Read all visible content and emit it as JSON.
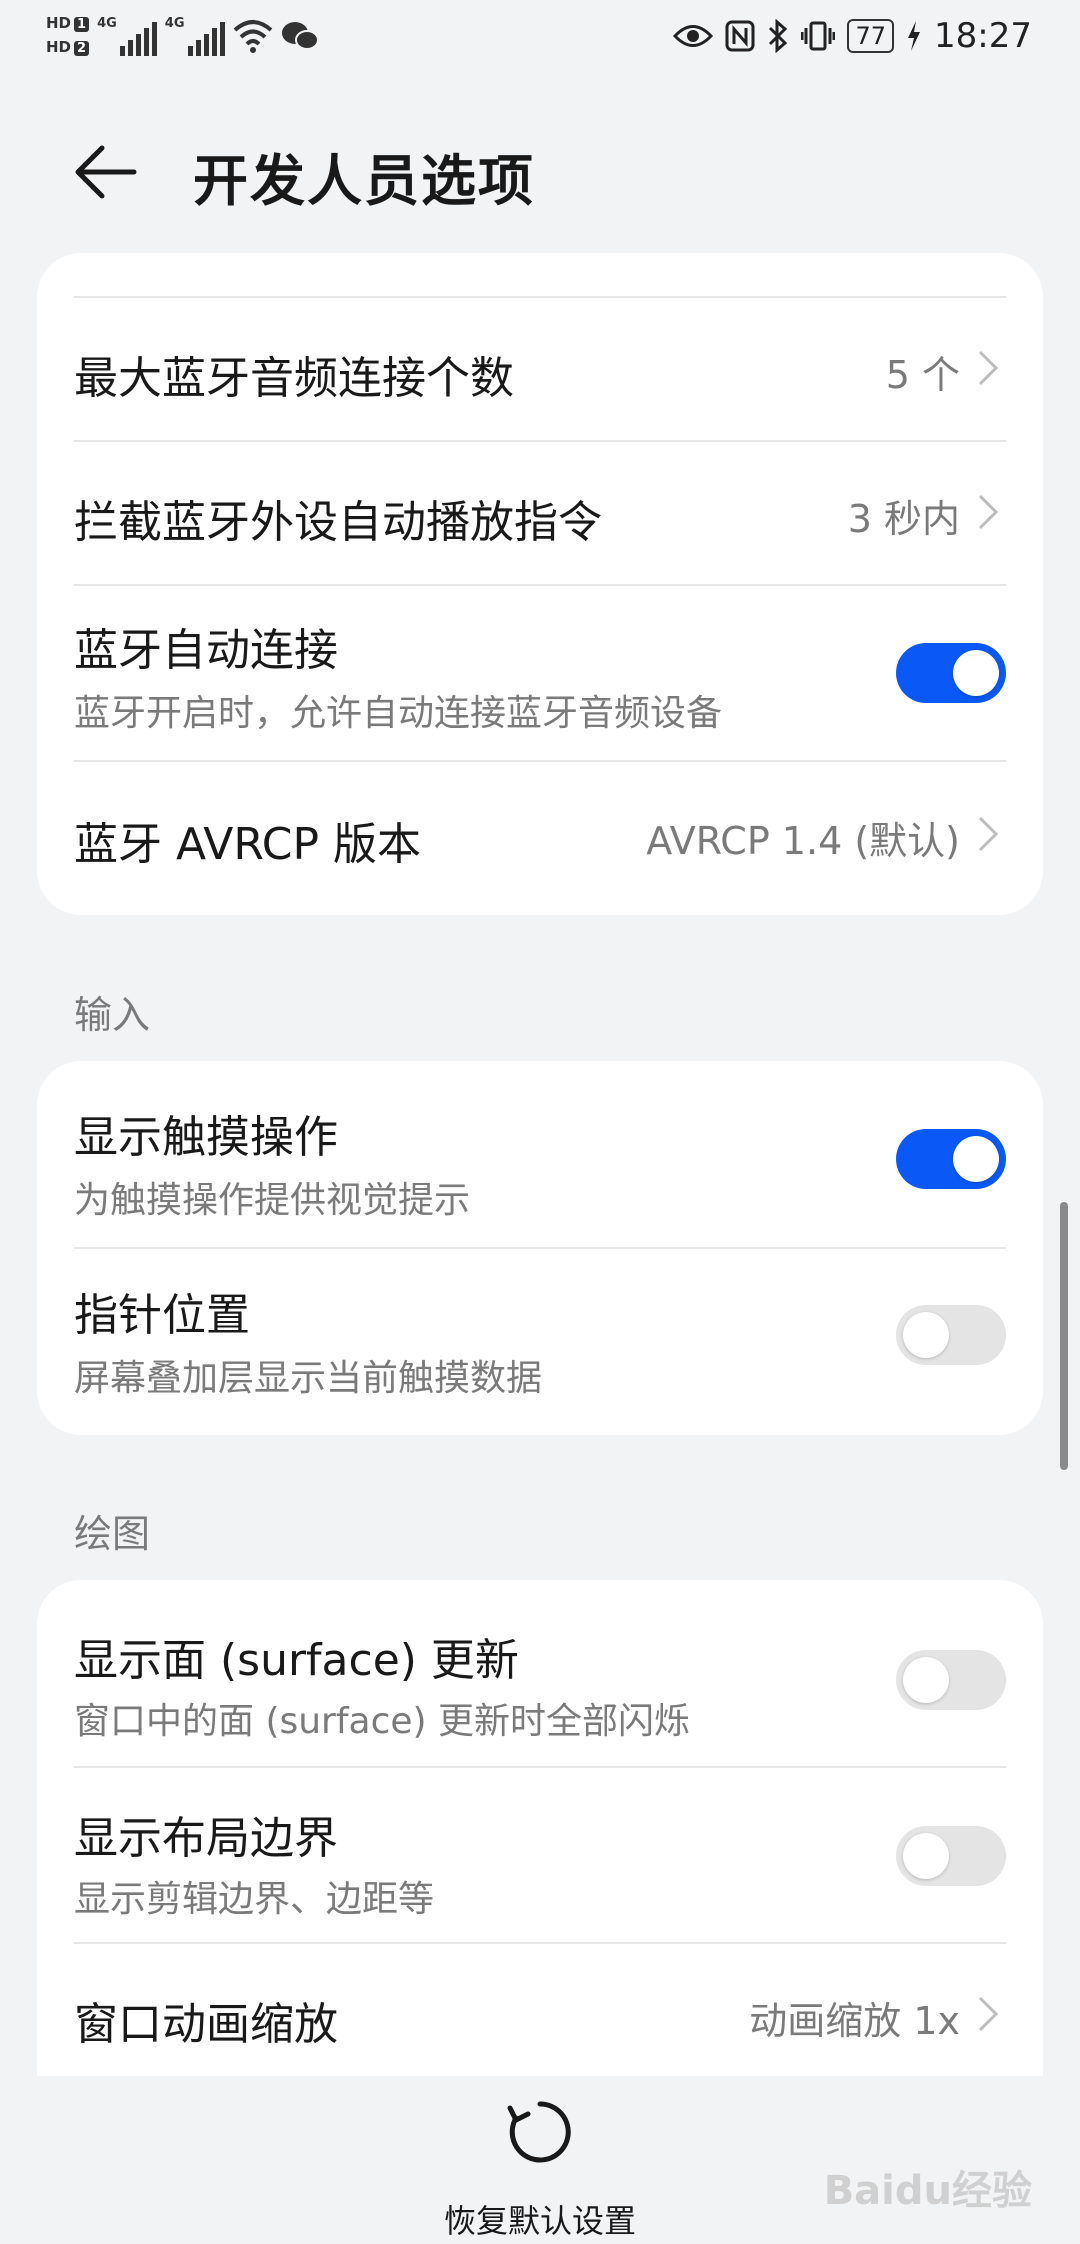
{
  "status_bar": {
    "sim1": "HD",
    "sim1_num": "1",
    "sim2": "HD",
    "sim2_num": "2",
    "net1": "4G",
    "net2": "4G",
    "battery": "77",
    "time": "18:27"
  },
  "header": {
    "title": "开发人员选项"
  },
  "bluetooth_card": {
    "max_audio": {
      "label": "最大蓝牙音频连接个数",
      "value": "5 个"
    },
    "intercept": {
      "label": "拦截蓝牙外设自动播放指令",
      "value": "3 秒内"
    },
    "auto_connect": {
      "label": "蓝牙自动连接",
      "sub": "蓝牙开启时，允许自动连接蓝牙音频设备",
      "on": true
    },
    "avrcp": {
      "label": "蓝牙 AVRCP 版本",
      "value": "AVRCP 1.4 (默认)"
    }
  },
  "input_section": {
    "label": "输入",
    "show_touches": {
      "label": "显示触摸操作",
      "sub": "为触摸操作提供视觉提示",
      "on": true
    },
    "pointer": {
      "label": "指针位置",
      "sub": "屏幕叠加层显示当前触摸数据",
      "on": false
    }
  },
  "drawing_section": {
    "label": "绘图",
    "surface": {
      "label": "显示面 (surface) 更新",
      "sub": "窗口中的面 (surface) 更新时全部闪烁",
      "on": false
    },
    "layout": {
      "label": "显示布局边界",
      "sub": "显示剪辑边界、边距等",
      "on": false
    },
    "window_anim": {
      "label": "窗口动画缩放",
      "value": "动画缩放 1x"
    }
  },
  "bottom": {
    "restore_label": "恢复默认设置",
    "watermark": "Baidu经验"
  },
  "colors": {
    "accent": "#0a59f7",
    "background": "#f1f3f5",
    "card": "#ffffff"
  }
}
